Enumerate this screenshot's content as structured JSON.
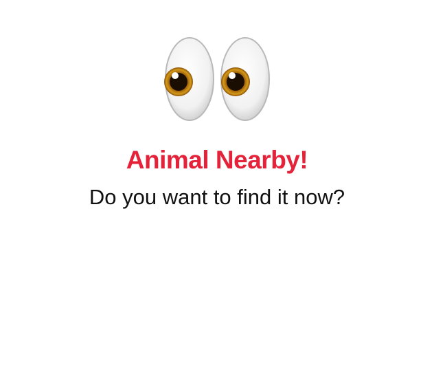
{
  "alert": {
    "icon": "eyes-icon",
    "title": "Animal Nearby!",
    "message": "Do you want to find it now?"
  },
  "colors": {
    "title": "#e4223a",
    "message": "#111111",
    "background": "#ffffff"
  }
}
